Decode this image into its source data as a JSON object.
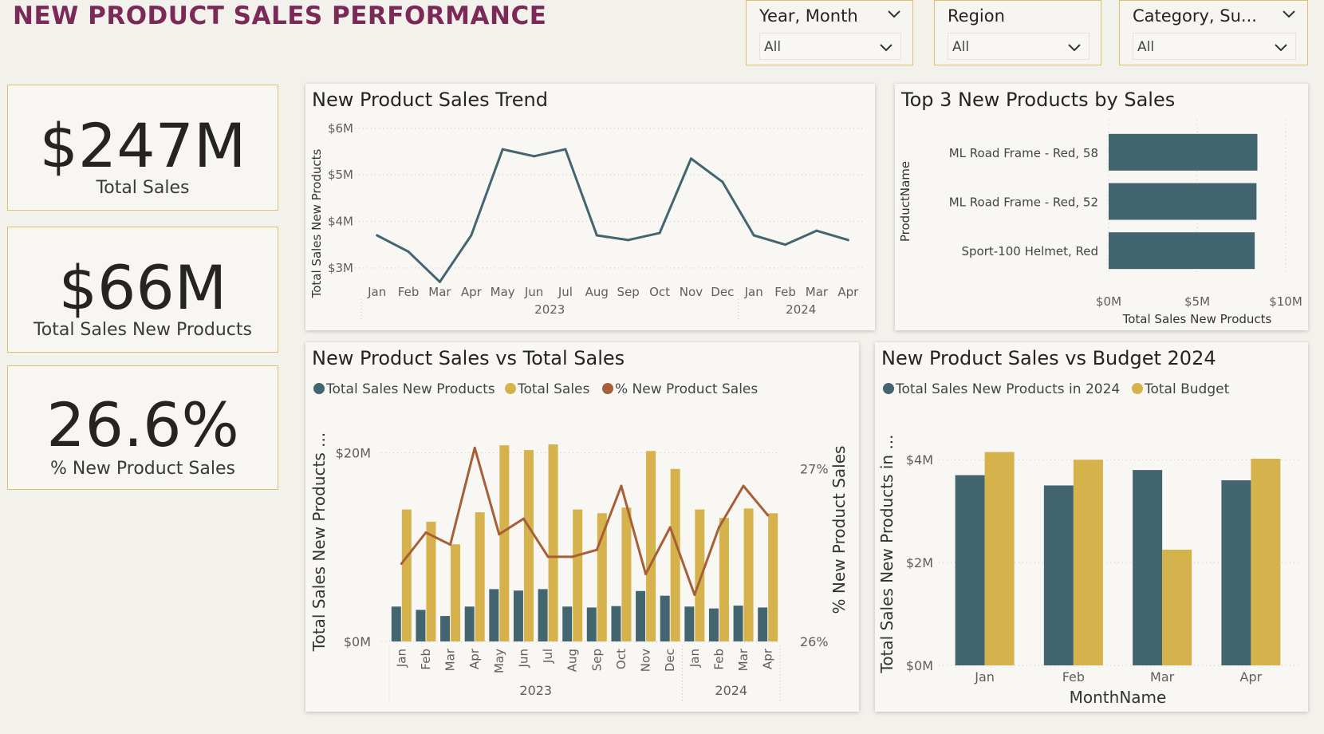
{
  "page": {
    "title": "NEW PRODUCT SALES PERFORMANCE"
  },
  "colors": {
    "teal": "#436570",
    "gold": "#d5b24c",
    "rust": "#a65f36",
    "title": "#7b2a57",
    "border": "#e1c06a"
  },
  "slicers": [
    {
      "label": "Year, Month",
      "value": "All"
    },
    {
      "label": "Region",
      "value": "All"
    },
    {
      "label": "Category, Su...",
      "value": "All"
    }
  ],
  "cards": [
    {
      "value": "$247M",
      "label": "Total Sales"
    },
    {
      "value": "$66M",
      "label": "Total Sales New Products"
    },
    {
      "value": "26.6%",
      "label": "% New Product Sales"
    }
  ],
  "chart_data": [
    {
      "type": "line",
      "title": "New Product Sales Trend",
      "ylabel": "Total Sales New Products",
      "x": [
        "Jan",
        "Feb",
        "Mar",
        "Apr",
        "May",
        "Jun",
        "Jul",
        "Aug",
        "Sep",
        "Oct",
        "Nov",
        "Dec",
        "Jan",
        "Feb",
        "Mar",
        "Apr"
      ],
      "x_groups": [
        {
          "label": "2023",
          "count": 12
        },
        {
          "label": "2024",
          "count": 4
        }
      ],
      "values": [
        3.7,
        3.35,
        2.7,
        3.7,
        5.55,
        5.4,
        5.55,
        3.7,
        3.6,
        3.75,
        5.35,
        4.85,
        3.7,
        3.5,
        3.8,
        3.6
      ],
      "yticks": [
        "$3M",
        "$4M",
        "$5M",
        "$6M"
      ],
      "ytick_values": [
        3,
        4,
        5,
        6
      ],
      "ylim": [
        2.5,
        6.1
      ],
      "grid": true
    },
    {
      "type": "bar",
      "orientation": "horizontal",
      "title": "Top 3 New Products by Sales",
      "ylabel": "ProductName",
      "xlabel": "Total Sales New Products",
      "categories": [
        "ML Road Frame - Red, 58",
        "ML Road Frame - Red, 52",
        "Sport-100 Helmet, Red"
      ],
      "values": [
        8.4,
        8.35,
        8.25
      ],
      "xticks": [
        "$0M",
        "$5M",
        "$10M"
      ],
      "xtick_values": [
        0,
        5,
        10
      ],
      "xlim": [
        0,
        10
      ],
      "grid": true
    },
    {
      "type": "bar",
      "title": "New Product Sales vs Total Sales",
      "legend": [
        "Total Sales New Products",
        "Total Sales",
        "% New Product Sales"
      ],
      "ylabel": "Total Sales New Products ...",
      "y2label": "% New Product Sales",
      "categories": [
        "Jan",
        "Feb",
        "Mar",
        "Apr",
        "May",
        "Jun",
        "Jul",
        "Aug",
        "Sep",
        "Oct",
        "Nov",
        "Dec",
        "Jan",
        "Feb",
        "Mar",
        "Apr"
      ],
      "x_groups": [
        {
          "label": "2023",
          "count": 12
        },
        {
          "label": "2024",
          "count": 4
        }
      ],
      "series": [
        {
          "name": "Total Sales New Products",
          "axis": "left",
          "values": [
            3.7,
            3.35,
            2.7,
            3.7,
            5.55,
            5.4,
            5.55,
            3.7,
            3.6,
            3.75,
            5.35,
            4.85,
            3.7,
            3.5,
            3.8,
            3.6
          ]
        },
        {
          "name": "Total Sales",
          "axis": "left",
          "values": [
            14.0,
            12.7,
            10.3,
            13.7,
            20.8,
            20.3,
            20.9,
            14.0,
            13.6,
            14.2,
            20.2,
            18.3,
            14.0,
            13.1,
            14.1,
            13.6
          ]
        },
        {
          "name": "% New Product Sales",
          "axis": "right",
          "type": "line",
          "values": [
            26.45,
            26.63,
            26.56,
            27.12,
            26.62,
            26.71,
            26.49,
            26.49,
            26.53,
            26.9,
            26.39,
            26.66,
            26.27,
            26.66,
            26.9,
            26.73
          ]
        }
      ],
      "yticks": [
        "$0M",
        "$20M"
      ],
      "ytick_values": [
        0,
        20
      ],
      "ylim": [
        0,
        22
      ],
      "y2ticks": [
        "26%",
        "27%"
      ],
      "y2tick_values": [
        26,
        27
      ],
      "y2lim": [
        26,
        27.2
      ],
      "grid": true
    },
    {
      "type": "bar",
      "title": "New Product Sales vs Budget 2024",
      "legend": [
        "Total Sales New Products in 2024",
        "Total Budget"
      ],
      "ylabel": "Total Sales New Products in ...",
      "xlabel": "MonthName",
      "categories": [
        "Jan",
        "Feb",
        "Mar",
        "Apr"
      ],
      "series": [
        {
          "name": "Total Sales New Products in 2024",
          "values": [
            3.7,
            3.5,
            3.8,
            3.6
          ]
        },
        {
          "name": "Total Budget",
          "values": [
            4.15,
            4.0,
            2.25,
            4.02
          ]
        }
      ],
      "yticks": [
        "$0M",
        "$2M",
        "$4M"
      ],
      "ytick_values": [
        0,
        2,
        4
      ],
      "ylim": [
        0,
        4.5
      ],
      "grid": true
    }
  ]
}
